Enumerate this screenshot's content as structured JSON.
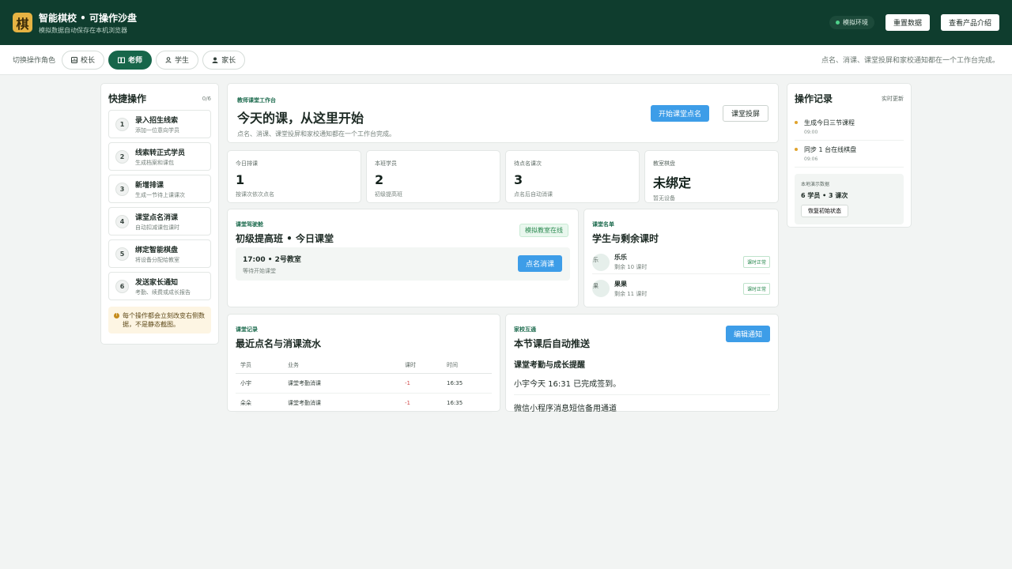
{
  "header": {
    "logo_char": "棋",
    "title": "智能棋校 • 可操作沙盘",
    "subtitle": "模拟数据自动保存在本机浏览器",
    "env_label": "模拟环境",
    "reset_label": "重置数据",
    "intro_label": "查看产品介绍"
  },
  "rolebar": {
    "label": "切换操作角色",
    "roles": [
      {
        "label": "校长",
        "icon": "chart-icon"
      },
      {
        "label": "老师",
        "icon": "book-icon",
        "active": true
      },
      {
        "label": "学生",
        "icon": "user-icon"
      },
      {
        "label": "家长",
        "icon": "person-icon"
      }
    ],
    "hint": "点名、消课、课堂投屏和家校通知都在一个工作台完成。"
  },
  "quick": {
    "title": "快捷操作",
    "count": "0/6",
    "items": [
      {
        "num": "1",
        "title": "录入招生线索",
        "sub": "添加一位意向学员"
      },
      {
        "num": "2",
        "title": "线索转正式学员",
        "sub": "生成档案和课包"
      },
      {
        "num": "3",
        "title": "新增排课",
        "sub": "生成一节待上课课次"
      },
      {
        "num": "4",
        "title": "课堂点名消课",
        "sub": "自动扣减课包课时"
      },
      {
        "num": "5",
        "title": "绑定智能棋盘",
        "sub": "将设备分配给教室"
      },
      {
        "num": "6",
        "title": "发送家长通知",
        "sub": "考勤、续费或成长报告"
      }
    ],
    "tip": "每个操作都会立刻改变右侧数据，不是静态截图。"
  },
  "hero": {
    "eyebrow": "教师课堂工作台",
    "title": "今天的课，从这里开始",
    "sub": "点名、消课、课堂投屏和家校通知都在一个工作台完成。",
    "primary_btn": "开始课堂点名",
    "secondary_btn": "课堂投屏"
  },
  "stats": [
    {
      "label": "今日排课",
      "value": "1",
      "sub": "按课次依次点名"
    },
    {
      "label": "本班学员",
      "value": "2",
      "sub": "初级提高班"
    },
    {
      "label": "待点名课次",
      "value": "3",
      "sub": "点名后自动消课"
    },
    {
      "label": "教室棋盘",
      "value": "未绑定",
      "sub": "暂无设备"
    }
  ],
  "cockpit": {
    "eyebrow": "课堂驾驶舱",
    "title": "初级提高班 • 今日课堂",
    "status": "模拟教室在线",
    "session_title": "17:00 • 2号教室",
    "session_sub": "等待开始课堂",
    "action": "点名消课"
  },
  "roster": {
    "eyebrow": "课堂名单",
    "title": "学生与剩余课时",
    "students": [
      {
        "avatar": "乐",
        "name": "乐乐",
        "remain": "剩余 10 课时",
        "badge": "课时正常"
      },
      {
        "avatar": "果",
        "name": "果果",
        "remain": "剩余 11 课时",
        "badge": "课时正常"
      }
    ]
  },
  "records": {
    "eyebrow": "课堂记录",
    "title": "最近点名与消课流水",
    "headers": [
      "学员",
      "业务",
      "课时",
      "时间"
    ],
    "rows": [
      [
        "小宇",
        "课堂考勤消课",
        "-1",
        "16:35"
      ],
      [
        "朵朵",
        "课堂考勤消课",
        "-1",
        "16:35"
      ]
    ]
  },
  "notify": {
    "eyebrow": "家校互通",
    "title": "本节课后自动推送",
    "edit_btn": "编辑通知",
    "heading": "课堂考勤与成长提醒",
    "line1": "小宇今天 16:31 已完成签到。",
    "line2": "微信小程序消息短信备用通道"
  },
  "log": {
    "title": "操作记录",
    "live": "实时更新",
    "items": [
      {
        "title": "生成今日三节课程",
        "time": "09:00"
      },
      {
        "title": "同步 1 台在线棋盘",
        "time": "09:06"
      }
    ],
    "local_label": "本地演示数据",
    "local_value": "6 学员 • 3 课次",
    "restore_btn": "恢复初始状态"
  }
}
